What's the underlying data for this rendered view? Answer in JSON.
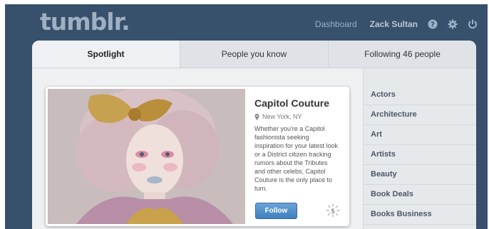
{
  "header": {
    "logo": "tumblr.",
    "nav": {
      "dashboard": "Dashboard",
      "user": "Zack Sultan"
    },
    "icons": [
      "help-icon",
      "gear-icon",
      "power-icon"
    ]
  },
  "tabs": [
    {
      "label": "Spotlight",
      "active": true
    },
    {
      "label": "People you know",
      "active": false
    },
    {
      "label": "Following 46 people",
      "active": false
    }
  ],
  "card": {
    "title": "Capitol Couture",
    "location": "New York, NY",
    "description": "Whether you're a Capitol fashionista seeking inspiration for your latest look or a District citizen tracking rumors about the Tributes and other celebs, Capitol Couture is the only place to turn.",
    "follow_label": "Follow",
    "badge_symbol": "$"
  },
  "categories": [
    "Actors",
    "Architecture",
    "Art",
    "Artists",
    "Beauty",
    "Book Deals",
    "Books Business"
  ],
  "colors": {
    "background": "#37506b",
    "accent": "#4a8ac8"
  }
}
